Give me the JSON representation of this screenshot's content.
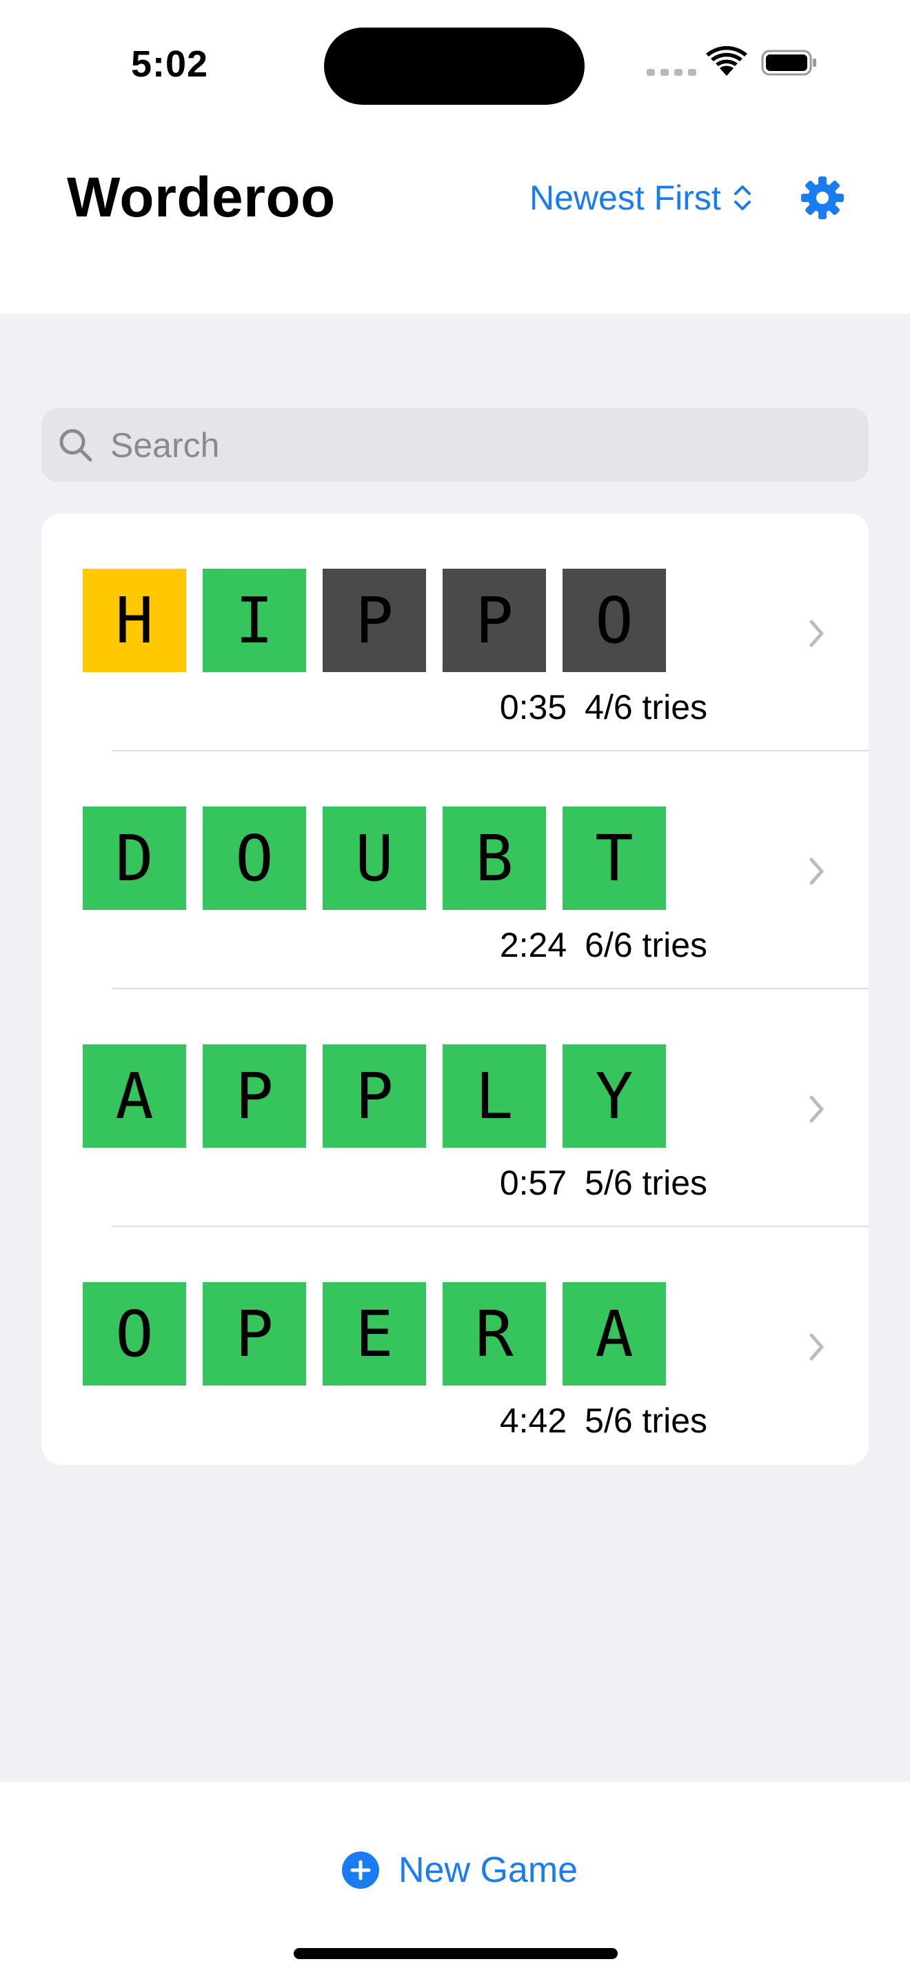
{
  "status_bar": {
    "time": "5:02"
  },
  "header": {
    "title": "Worderoo",
    "sort_label": "Newest First"
  },
  "search": {
    "placeholder": "Search",
    "value": ""
  },
  "games": [
    {
      "letters": [
        "H",
        "I",
        "P",
        "P",
        "O"
      ],
      "states": [
        "present",
        "correct",
        "absent",
        "absent",
        "absent"
      ],
      "time": "0:35",
      "tries": "4/6 tries"
    },
    {
      "letters": [
        "D",
        "O",
        "U",
        "B",
        "T"
      ],
      "states": [
        "correct",
        "correct",
        "correct",
        "correct",
        "correct"
      ],
      "time": "2:24",
      "tries": "6/6 tries"
    },
    {
      "letters": [
        "A",
        "P",
        "P",
        "L",
        "Y"
      ],
      "states": [
        "correct",
        "correct",
        "correct",
        "correct",
        "correct"
      ],
      "time": "0:57",
      "tries": "5/6 tries"
    },
    {
      "letters": [
        "O",
        "P",
        "E",
        "R",
        "A"
      ],
      "states": [
        "correct",
        "correct",
        "correct",
        "correct",
        "correct"
      ],
      "time": "4:42",
      "tries": "5/6 tries"
    }
  ],
  "toolbar": {
    "new_game_label": "New Game"
  },
  "colors": {
    "accent": "#1a7cf3",
    "correct": "#36c55c",
    "present": "#ffc800",
    "absent": "#4a4a4a",
    "background": "#f0f0f5"
  },
  "icons": {
    "sort": "chevron-up-down-icon",
    "settings": "gear-icon",
    "search": "magnifying-glass-icon",
    "row_disclosure": "chevron-right-icon",
    "new_game": "plus-circle-icon"
  }
}
